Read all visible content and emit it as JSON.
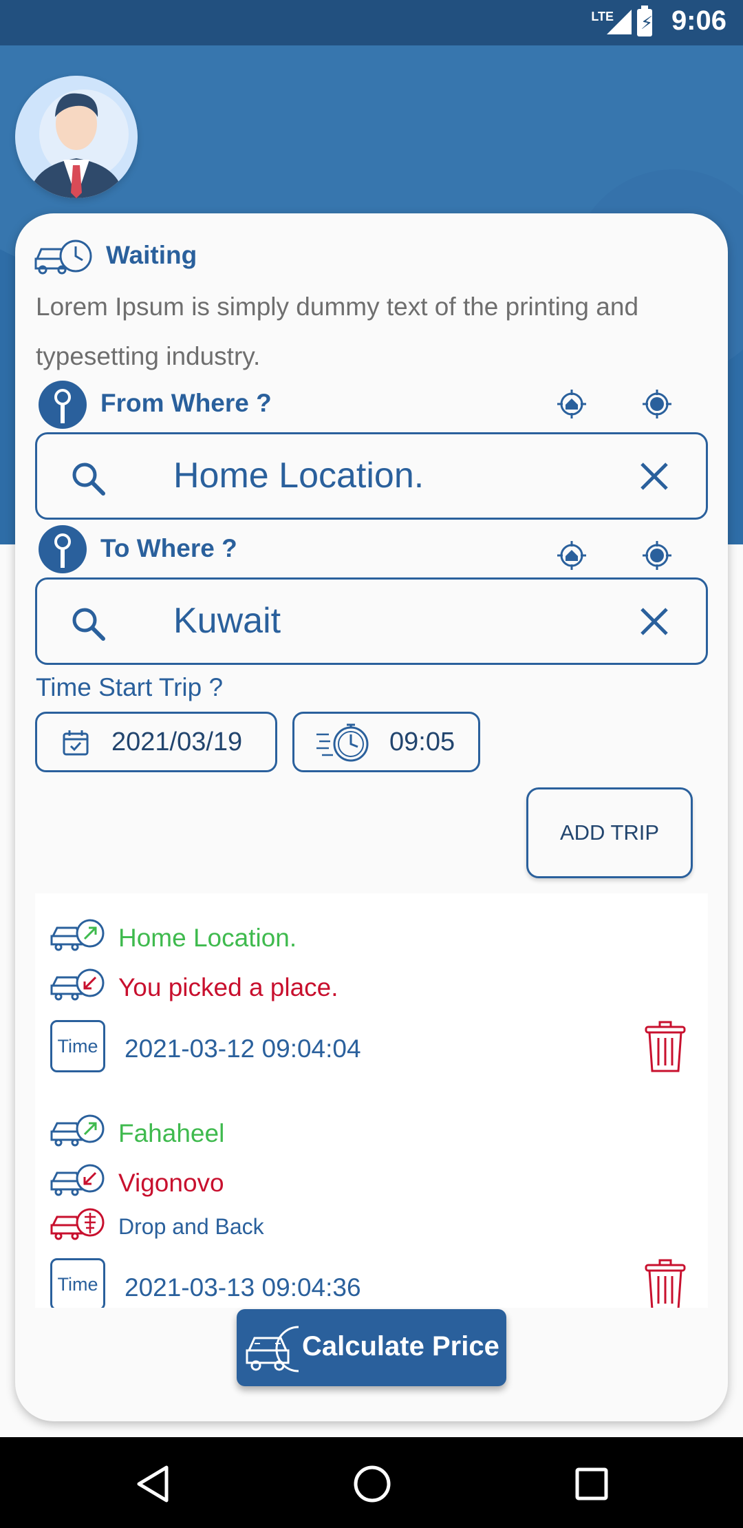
{
  "status_bar": {
    "network": "LTE",
    "time": "9:06"
  },
  "header": {
    "avatar": "user-avatar"
  },
  "card": {
    "title": "Waiting",
    "description": "Lorem Ipsum is simply dummy text of the printing and typesetting industry."
  },
  "from": {
    "label": "From Where ?",
    "value": "Home Location."
  },
  "to": {
    "label": "To Where ?",
    "value": "Kuwait"
  },
  "time_start": {
    "label": "Time Start Trip ?",
    "date": "2021/03/19",
    "time": "09:05"
  },
  "add_trip_label": "ADD TRIP",
  "trips": [
    {
      "from": "Home Location.",
      "to": "You picked a place.",
      "time_label": "Time",
      "time": "2021-03-12 09:04:04"
    },
    {
      "from": "Fahaheel",
      "to": "Vigonovo",
      "type": "Drop and Back",
      "time_label": "Time",
      "time": "2021-03-13 09:04:36"
    }
  ],
  "calculate_label": "Calculate Price",
  "colors": {
    "primary": "#2a609c",
    "status_bar": "#22507f",
    "from": "#3fba4e",
    "to": "#c8102e"
  },
  "icons": [
    "car-clock-icon",
    "key-icon",
    "home-target-icon",
    "gps-target-icon",
    "search-icon",
    "close-icon",
    "calendar-icon",
    "stopwatch-icon",
    "car-up-arrow-icon",
    "car-down-arrow-icon",
    "car-route-icon",
    "trash-icon",
    "car-calc-icon",
    "back-nav-icon",
    "home-nav-icon",
    "recents-nav-icon"
  ]
}
